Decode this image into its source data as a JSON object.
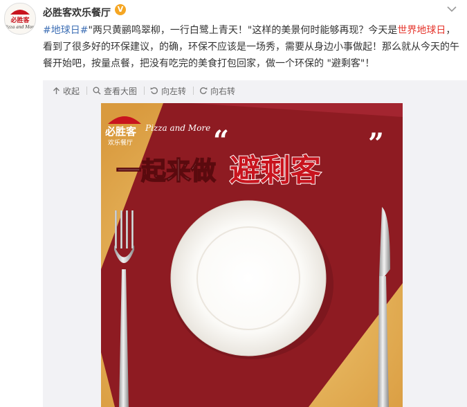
{
  "post": {
    "author": "必胜客欢乐餐厅",
    "verified_badge": "V",
    "text_segments": [
      {
        "text": "#地球日#",
        "style": "link"
      },
      {
        "text": "\"两只黄鹂鸣翠柳，一行白鹭上青天！\"这样的美景何时能够再现？今天是",
        "style": "normal"
      },
      {
        "text": "世界地球日",
        "style": "red"
      },
      {
        "text": "，看到了很多好的环保建议，的确，环保不应该是一场秀，需要从身边小事做起！那么就从今天的午餐开始吧，按量点餐，把没有吃完的美食打包回家，做一个环保的 \"避剩客\"！",
        "style": "normal"
      }
    ]
  },
  "toolbar": {
    "collapse": "收起",
    "view_large": "查看大图",
    "rotate_left": "向左转",
    "rotate_right": "向右转"
  },
  "image": {
    "logo_text": "必胜客",
    "logo_sub": "欢乐餐厅",
    "script_text": "Pizza and More",
    "headline_prefix": "一起来做",
    "headline_main": "避剩客",
    "colors": {
      "background": "#e3b05a",
      "napkin": "#8e1b22",
      "headline_red": "#c8141e",
      "plate": "#ffffff"
    }
  },
  "icons": {
    "collapse": "up-arrow-icon",
    "view_large": "magnifier-icon",
    "rotate_left": "rotate-left-icon",
    "rotate_right": "rotate-right-icon",
    "menu": "chevron-down-icon"
  }
}
